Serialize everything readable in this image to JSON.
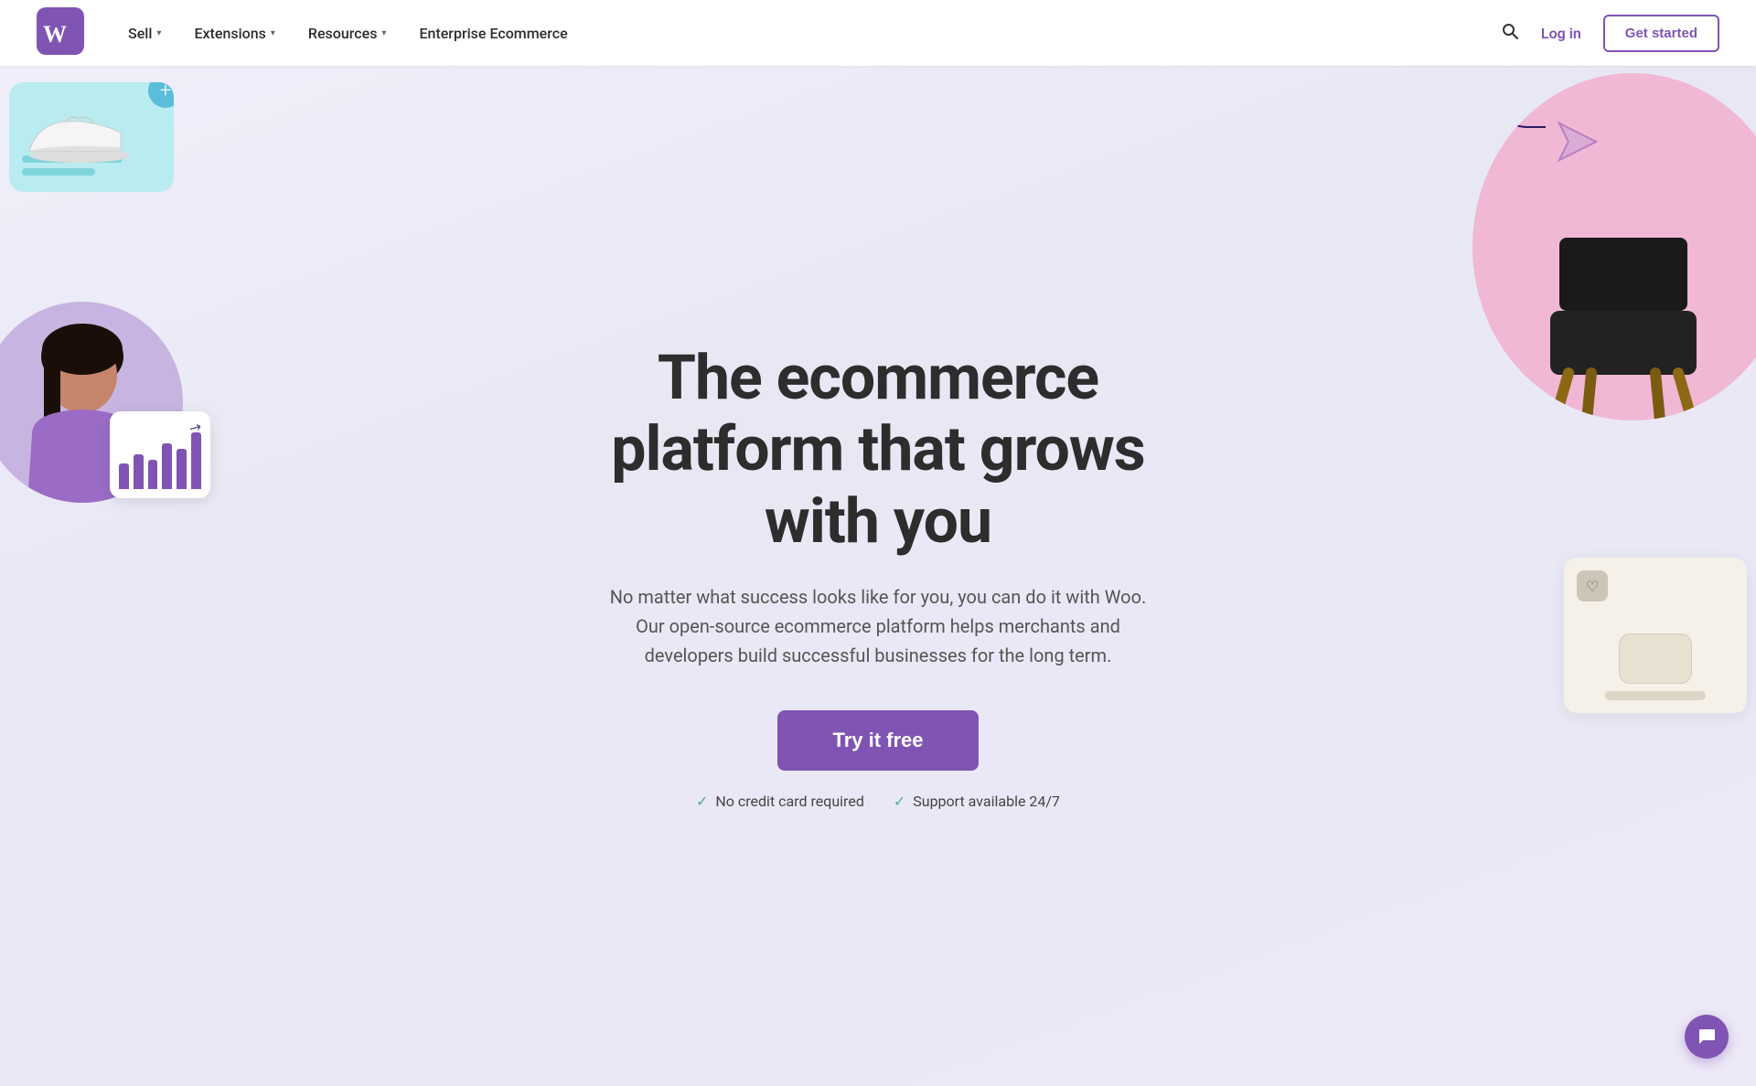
{
  "nav": {
    "logo_alt": "WooCommerce",
    "links": [
      {
        "label": "Sell",
        "has_dropdown": true
      },
      {
        "label": "Extensions",
        "has_dropdown": true
      },
      {
        "label": "Resources",
        "has_dropdown": true
      },
      {
        "label": "Enterprise Ecommerce",
        "has_dropdown": false
      }
    ],
    "login_label": "Log in",
    "get_started_label": "Get started"
  },
  "hero": {
    "title": "The ecommerce platform that grows with you",
    "subtitle": "No matter what success looks like for you, you can do it with Woo. Our open-source ecommerce platform helps merchants and developers build successful businesses for the long term.",
    "cta_label": "Try it free",
    "badge1": "No credit card required",
    "badge2": "Support available 24/7"
  },
  "colors": {
    "brand_purple": "#7f54b3",
    "accent_teal": "#5bbdd8",
    "accent_pink": "#f0b8d4",
    "accent_mint": "#b8ecf0"
  },
  "chart": {
    "bars": [
      30,
      50,
      40,
      70,
      60,
      85
    ]
  }
}
